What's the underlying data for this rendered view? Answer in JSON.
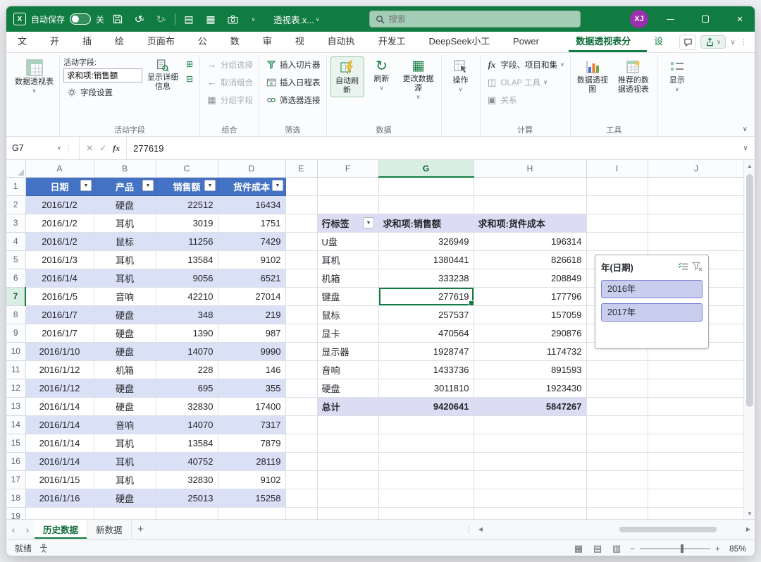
{
  "titlebar": {
    "autosave_label": "自动保存",
    "autosave_state": "关",
    "filename": "透视表.x...",
    "search_placeholder": "搜索",
    "avatar": "XJ"
  },
  "icons": {
    "chev": "∨",
    "undo": "↺",
    "redo": "↻",
    "close": "×",
    "dots": "⋮",
    "up": "▲",
    "down": "▼",
    "left": "◀",
    "right": "▶",
    "prev": "‹",
    "next": "›",
    "check": "✓",
    "cancel": "✕",
    "fx": "fx",
    "plus": "+",
    "minus": "−",
    "filter_arrow": "▼",
    "sheet": "▤",
    "grid": "▦",
    "pagebreak": "▥",
    "expand": "⊞",
    "collapse": "⊟",
    "add": "+",
    "arrow_right": "→",
    "arrow_left": "←",
    "olap": "◫",
    "rel": "▣"
  },
  "ribbon": {
    "tabs": [
      "文件",
      "开始",
      "插入",
      "绘图",
      "页面布局",
      "公式",
      "数据",
      "审阅",
      "视图",
      "自动执行",
      "开发工具",
      "DeepSeek小工具",
      "Power Pivot",
      "数据透视表分析",
      "设计"
    ],
    "active_tab": "数据透视表分析",
    "contextual_tabs": [
      "数据透视表分析",
      "设计"
    ],
    "pivottable_button": "数据透视表",
    "active_field": {
      "group_label": "活动字段",
      "label": "活动字段:",
      "value": "求和项:销售额",
      "field_settings": "字段设置",
      "show_detail": "显示详细信息"
    },
    "group_combine": {
      "label": "组合",
      "items": [
        "分组选择",
        "取消组合",
        "分组字段"
      ]
    },
    "group_filter": {
      "label": "筛选",
      "items": [
        "插入切片器",
        "插入日程表",
        "筛选器连接"
      ]
    },
    "group_data": {
      "label": "数据",
      "auto_refresh": "自动刷新",
      "refresh": "刷新",
      "change_source": "更改数据源"
    },
    "actions_button": "操作",
    "group_calc": {
      "label": "计算",
      "items": [
        "字段、项目和集",
        "OLAP 工具",
        "关系"
      ]
    },
    "group_tools": {
      "label": "工具",
      "pivot_chart": "数据透视图",
      "recommended": "推荐的数据透视表"
    },
    "show_button": "显示"
  },
  "formula_bar": {
    "name_box": "G7",
    "value": "277619"
  },
  "sheet": {
    "columns": [
      "A",
      "B",
      "C",
      "D",
      "E",
      "F",
      "G",
      "H",
      "I",
      "J"
    ],
    "rows": [
      "1",
      "2",
      "3",
      "4",
      "5",
      "6",
      "7",
      "8",
      "9",
      "10",
      "11",
      "12",
      "13",
      "14",
      "15",
      "16",
      "17",
      "18",
      "19"
    ],
    "selected": "G7",
    "cells": [
      [
        "日期",
        "产品",
        "销售额",
        "货件成本",
        "",
        "",
        "",
        "",
        "",
        ""
      ],
      [
        "2016/1/2",
        "硬盘",
        "22512",
        "16434",
        "",
        "",
        "",
        "",
        "",
        ""
      ],
      [
        "2016/1/2",
        "耳机",
        "3019",
        "1751",
        "",
        "行标签",
        "求和项:销售额",
        "求和项:货件成本",
        "",
        ""
      ],
      [
        "2016/1/2",
        "鼠标",
        "11256",
        "7429",
        "",
        "U盘",
        "326949",
        "196314",
        "",
        ""
      ],
      [
        "2016/1/3",
        "耳机",
        "13584",
        "9102",
        "",
        "耳机",
        "1380441",
        "826618",
        "",
        ""
      ],
      [
        "2016/1/4",
        "耳机",
        "9056",
        "6521",
        "",
        "机箱",
        "333238",
        "208849",
        "",
        ""
      ],
      [
        "2016/1/5",
        "音响",
        "42210",
        "27014",
        "",
        "键盘",
        "277619",
        "177796",
        "",
        ""
      ],
      [
        "2016/1/7",
        "硬盘",
        "348",
        "219",
        "",
        "鼠标",
        "257537",
        "157059",
        "",
        ""
      ],
      [
        "2016/1/7",
        "硬盘",
        "1390",
        "987",
        "",
        "显卡",
        "470564",
        "290876",
        "",
        ""
      ],
      [
        "2016/1/10",
        "硬盘",
        "14070",
        "9990",
        "",
        "显示器",
        "1928747",
        "1174732",
        "",
        ""
      ],
      [
        "2016/1/12",
        "机箱",
        "228",
        "146",
        "",
        "音响",
        "1433736",
        "891593",
        "",
        ""
      ],
      [
        "2016/1/12",
        "硬盘",
        "695",
        "355",
        "",
        "硬盘",
        "3011810",
        "1923430",
        "",
        ""
      ],
      [
        "2016/1/14",
        "硬盘",
        "32830",
        "17400",
        "",
        "总计",
        "9420641",
        "5847267",
        "",
        ""
      ],
      [
        "2016/1/14",
        "音响",
        "14070",
        "7317",
        "",
        "",
        "",
        "",
        "",
        ""
      ],
      [
        "2016/1/14",
        "耳机",
        "13584",
        "7879",
        "",
        "",
        "",
        "",
        "",
        ""
      ],
      [
        "2016/1/14",
        "耳机",
        "40752",
        "28119",
        "",
        "",
        "",
        "",
        "",
        ""
      ],
      [
        "2016/1/15",
        "耳机",
        "32830",
        "9102",
        "",
        "",
        "",
        "",
        "",
        ""
      ],
      [
        "2016/1/16",
        "硬盘",
        "25013",
        "15258",
        "",
        "",
        "",
        "",
        "",
        ""
      ],
      [
        "",
        "",
        "",
        "",
        "",
        "",
        "",
        "",
        "",
        ""
      ]
    ]
  },
  "slicer": {
    "title": "年(日期)",
    "items": [
      "2016年",
      "2017年"
    ]
  },
  "tabs_bar": {
    "sheets": [
      "历史数据",
      "新数据"
    ],
    "active": "历史数据"
  },
  "status_bar": {
    "ready": "就绪",
    "zoom": "85%"
  }
}
